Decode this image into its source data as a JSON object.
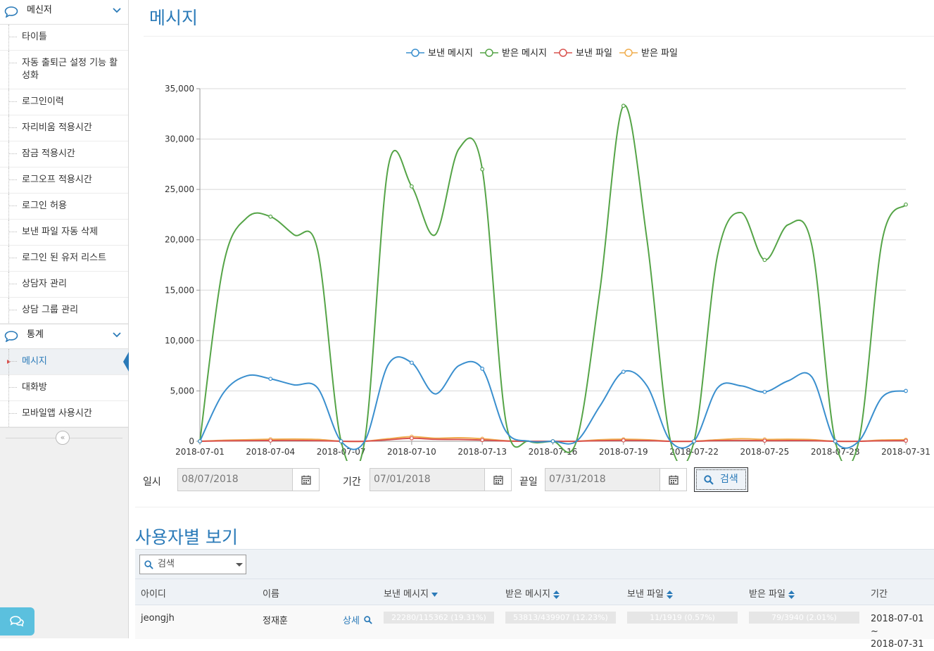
{
  "sidebar": {
    "sections": [
      {
        "title": "메신저",
        "items": [
          "타이틀",
          "자동 출퇴근 설정 기능 활성화",
          "로그인이력",
          "자리비움 적용시간",
          "잠금 적용시간",
          "로그오프 적용시간",
          "로그인 허용",
          "보낸 파일 자동 삭제",
          "로그인 된 유저 리스트",
          "상담자 관리",
          "상담 그룹 관리"
        ]
      },
      {
        "title": "통계",
        "items": [
          "메시지",
          "대화방",
          "모바일앱 사용시간"
        ],
        "active_item": "메시지"
      }
    ],
    "collapse_icon": "double-chevron-left-icon",
    "chat_icon": "chat-icon"
  },
  "page": {
    "title": "메시지"
  },
  "chart_data": {
    "type": "line",
    "legend_position": "top",
    "grid": true,
    "ylim": [
      0,
      35000
    ],
    "y_ticks": [
      "0",
      "5,000",
      "10,000",
      "15,000",
      "20,000",
      "25,000",
      "30,000",
      "35,000"
    ],
    "x_tick_labels": [
      "2018-07-01",
      "2018-07-04",
      "2018-07-07",
      "2018-07-10",
      "2018-07-13",
      "2018-07-16",
      "2018-07-19",
      "2018-07-22",
      "2018-07-25",
      "2018-07-28",
      "2018-07-31"
    ],
    "x": [
      "2018-07-01",
      "2018-07-02",
      "2018-07-03",
      "2018-07-04",
      "2018-07-05",
      "2018-07-06",
      "2018-07-07",
      "2018-07-08",
      "2018-07-09",
      "2018-07-10",
      "2018-07-11",
      "2018-07-12",
      "2018-07-13",
      "2018-07-14",
      "2018-07-15",
      "2018-07-16",
      "2018-07-17",
      "2018-07-18",
      "2018-07-19",
      "2018-07-20",
      "2018-07-21",
      "2018-07-22",
      "2018-07-23",
      "2018-07-24",
      "2018-07-25",
      "2018-07-26",
      "2018-07-27",
      "2018-07-28",
      "2018-07-29",
      "2018-07-30",
      "2018-07-31"
    ],
    "series": [
      {
        "name": "보낸 메시지",
        "color": "#3a8fce",
        "values": [
          0,
          4800,
          6500,
          6200,
          5600,
          5300,
          0,
          0,
          7600,
          7800,
          4700,
          7500,
          7200,
          1000,
          0,
          0,
          0,
          3500,
          6900,
          5500,
          0,
          0,
          5300,
          5500,
          4900,
          6000,
          6400,
          0,
          0,
          4400,
          5000
        ]
      },
      {
        "name": "받은 메시지",
        "color": "#55a447",
        "values": [
          0,
          17500,
          22200,
          22300,
          20500,
          19000,
          0,
          0,
          27200,
          25300,
          20500,
          29000,
          27000,
          2000,
          0,
          0,
          0,
          15000,
          33300,
          20000,
          0,
          0,
          18500,
          22700,
          18000,
          21500,
          19500,
          0,
          0,
          20000,
          23500
        ]
      },
      {
        "name": "보낸 파일",
        "color": "#d9534f",
        "values": [
          0,
          40,
          60,
          70,
          80,
          60,
          0,
          0,
          150,
          300,
          200,
          180,
          120,
          30,
          0,
          0,
          0,
          60,
          90,
          70,
          0,
          0,
          70,
          80,
          60,
          70,
          60,
          0,
          0,
          50,
          60
        ]
      },
      {
        "name": "받은 파일",
        "color": "#f0ad4e",
        "values": [
          0,
          100,
          150,
          200,
          220,
          180,
          0,
          0,
          250,
          450,
          300,
          350,
          250,
          50,
          0,
          0,
          0,
          150,
          200,
          150,
          0,
          0,
          150,
          250,
          180,
          200,
          160,
          0,
          0,
          120,
          150
        ]
      }
    ]
  },
  "filters": {
    "date_label": "일시",
    "date_value": "08/07/2018",
    "period_label": "기간",
    "period_start": "07/01/2018",
    "end_label": "끝일",
    "period_end": "07/31/2018",
    "search_label": "검색"
  },
  "users": {
    "title": "사용자별 보기",
    "search_select": "검색",
    "columns": [
      "아이디",
      "이름",
      "보낸 메시지",
      "받은 메시지",
      "보낸 파일",
      "받은 파일",
      "기간"
    ],
    "rows": [
      {
        "id": "jeongjh",
        "name": "정재훈",
        "detail": "상세",
        "sent_msg": "22280/115362 (19.31%)",
        "sent_msg_pct": 0.1931,
        "recv_msg": "53813/439907 (12.23%)",
        "recv_msg_pct": 0.1223,
        "sent_file": "11/1919 (0.57%)",
        "sent_file_pct": 0.0057,
        "recv_file": "79/3940 (2.01%)",
        "recv_file_pct": 0.0201,
        "period_start": "2018-07-01 ~",
        "period_end": "2018-07-31"
      }
    ]
  }
}
